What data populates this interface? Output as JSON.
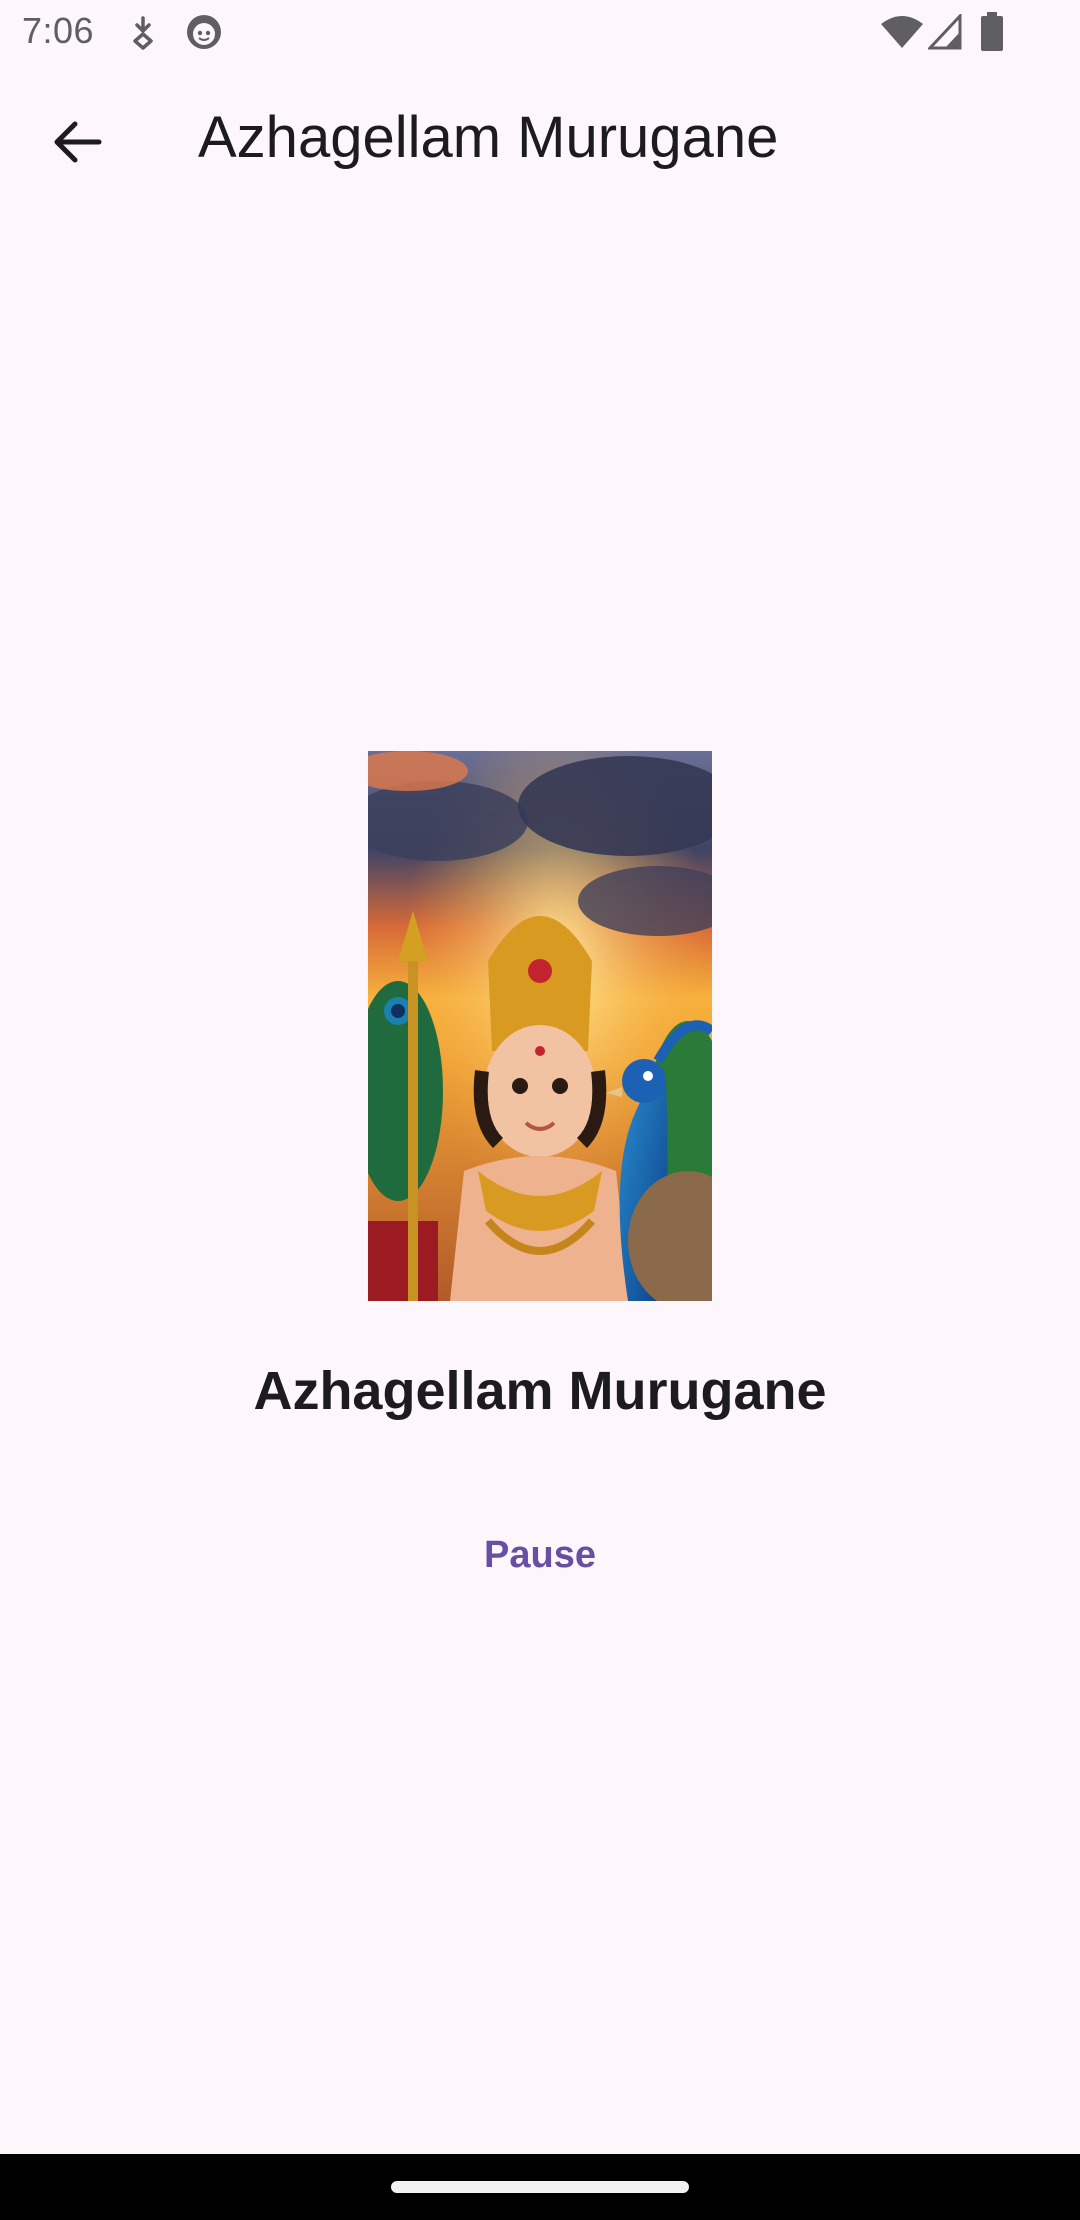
{
  "status_bar": {
    "time": "7:06",
    "left_icons": [
      "download-icon",
      "smiley-icon"
    ],
    "right_icons": [
      "wifi-icon",
      "signal-icon",
      "battery-icon"
    ]
  },
  "app_bar": {
    "back_icon": "arrow-back-icon",
    "title": "Azhagellam Murugane"
  },
  "player": {
    "song_title": "Azhagellam Murugane",
    "pause_label": "Pause",
    "accent_color": "#6750a4"
  },
  "colors": {
    "background": "#fdf6fb",
    "text": "#1c1b1f",
    "nav_bar": "#000000"
  }
}
